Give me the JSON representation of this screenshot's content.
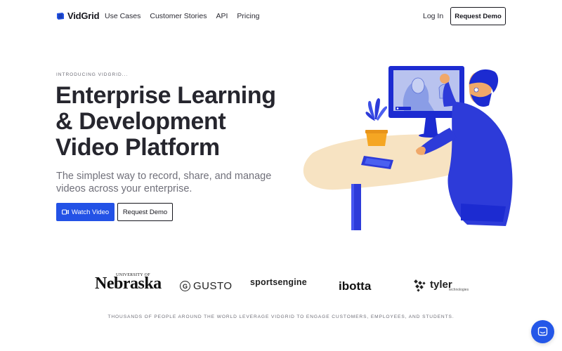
{
  "nav": {
    "logo_text": "VidGrid",
    "links": [
      "Use Cases",
      "Customer Stories",
      "API",
      "Pricing"
    ],
    "login": "Log In",
    "cta": "Request Demo"
  },
  "hero": {
    "eyebrow": "INTRODUCING VIDGRID...",
    "title": "Enterprise Learning & Development Video Platform",
    "subtitle": "The simplest way to record, share, and manage videos across your enterprise.",
    "primary_button": "Watch Video",
    "secondary_button": "Request Demo"
  },
  "customers": {
    "nebraska": {
      "main": "Nebraska",
      "small": "UNIVERSITY OF"
    },
    "gusto": {
      "mark": "G",
      "text": "GUSTO"
    },
    "sportsengine": "sportsengine",
    "ibotta": "ibotta",
    "tyler": {
      "main": "tyler",
      "sub": "technologies"
    }
  },
  "tagline": "THOUSANDS OF PEOPLE AROUND THE WORLD LEVERAGE VIDGRID TO ENGAGE CUSTOMERS, EMPLOYEES, AND STUDENTS.",
  "colors": {
    "brand_blue": "#2352e6",
    "dark_text": "#26262e",
    "muted_text": "#70707a",
    "desk": "#f7e3c2"
  },
  "icons": {
    "logo": "vidgrid-logo-icon",
    "video": "video-camera-icon",
    "chat": "chat-bubble-icon"
  }
}
